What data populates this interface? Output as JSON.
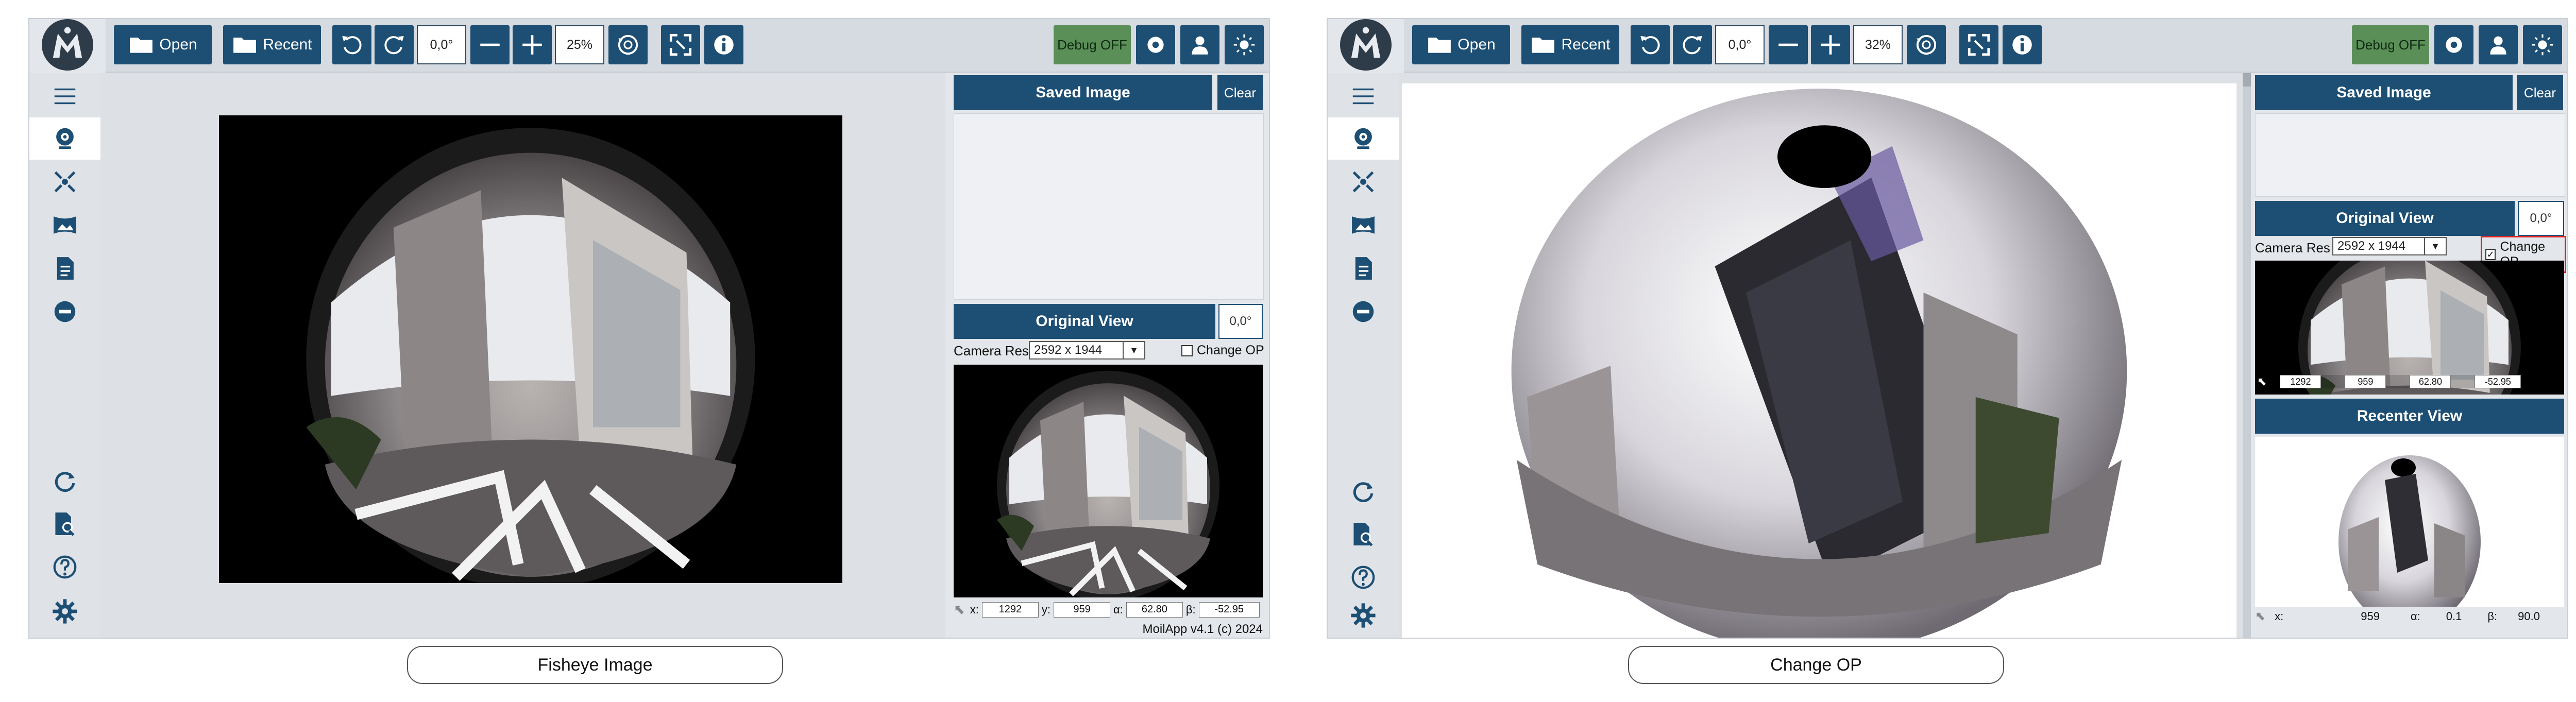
{
  "toolbar": {
    "open_label": "Open",
    "recent_label": "Recent",
    "debug_label": "Debug OFF"
  },
  "panels": [
    {
      "angle_value": "0,0°",
      "zoom_value": "25%",
      "saved_image_title": "Saved Image",
      "clear_label": "Clear",
      "original_view_title": "Original View",
      "original_view_angle": "0,0°",
      "camera_res_label": "Camera Res :",
      "camera_res_value": "2592 x 1944",
      "change_op_label": "Change OP",
      "change_op_checked": false,
      "coords": {
        "x_label": "x:",
        "x": "1292",
        "y_label": "y:",
        "y": "959",
        "alpha_label": "α:",
        "alpha": "62.80",
        "beta_label": "β:",
        "beta": "-52.95"
      },
      "version": "MoilApp v4.1 (c) 2024",
      "caption": "Fisheye Image"
    },
    {
      "angle_value": "0,0°",
      "zoom_value": "32%",
      "saved_image_title": "Saved Image",
      "clear_label": "Clear",
      "original_view_title": "Original View",
      "original_view_angle": "0,0°",
      "camera_res_label": "Camera Res :",
      "camera_res_value": "2592 x 1944",
      "change_op_label": "Change OP",
      "change_op_checked": true,
      "coords": {
        "x": "1292",
        "y": "959",
        "alpha": "62.80",
        "beta": "-52.95"
      },
      "recenter_view_title": "Recenter View",
      "recenter_coords": {
        "x_label": "x:",
        "y": "959",
        "alpha_label": "α:",
        "alpha": "0.1",
        "beta_label": "β:",
        "beta": "90.0"
      },
      "caption": "Change OP"
    }
  ],
  "icons": {
    "logo": "moil-logo-icon",
    "sidebar": [
      "hamburger-menu-icon",
      "webcam-icon",
      "anypoint-mode-icon",
      "panorama-icon",
      "document-icon",
      "minus-circle-icon",
      "refresh-icon",
      "search-document-icon",
      "help-icon",
      "settings-icon"
    ],
    "toolbar": [
      "folder-open-icon",
      "folder-recent-icon",
      "rotate-left-icon",
      "rotate-right-icon",
      "zoom-out-icon",
      "zoom-in-icon",
      "reset-view-icon",
      "fullscreen-icon",
      "info-icon",
      "record-icon",
      "user-icon",
      "theme-icon"
    ]
  },
  "colors": {
    "accent": "#1d4e73",
    "debug": "#5b8f58",
    "highlight": "#e02020"
  }
}
